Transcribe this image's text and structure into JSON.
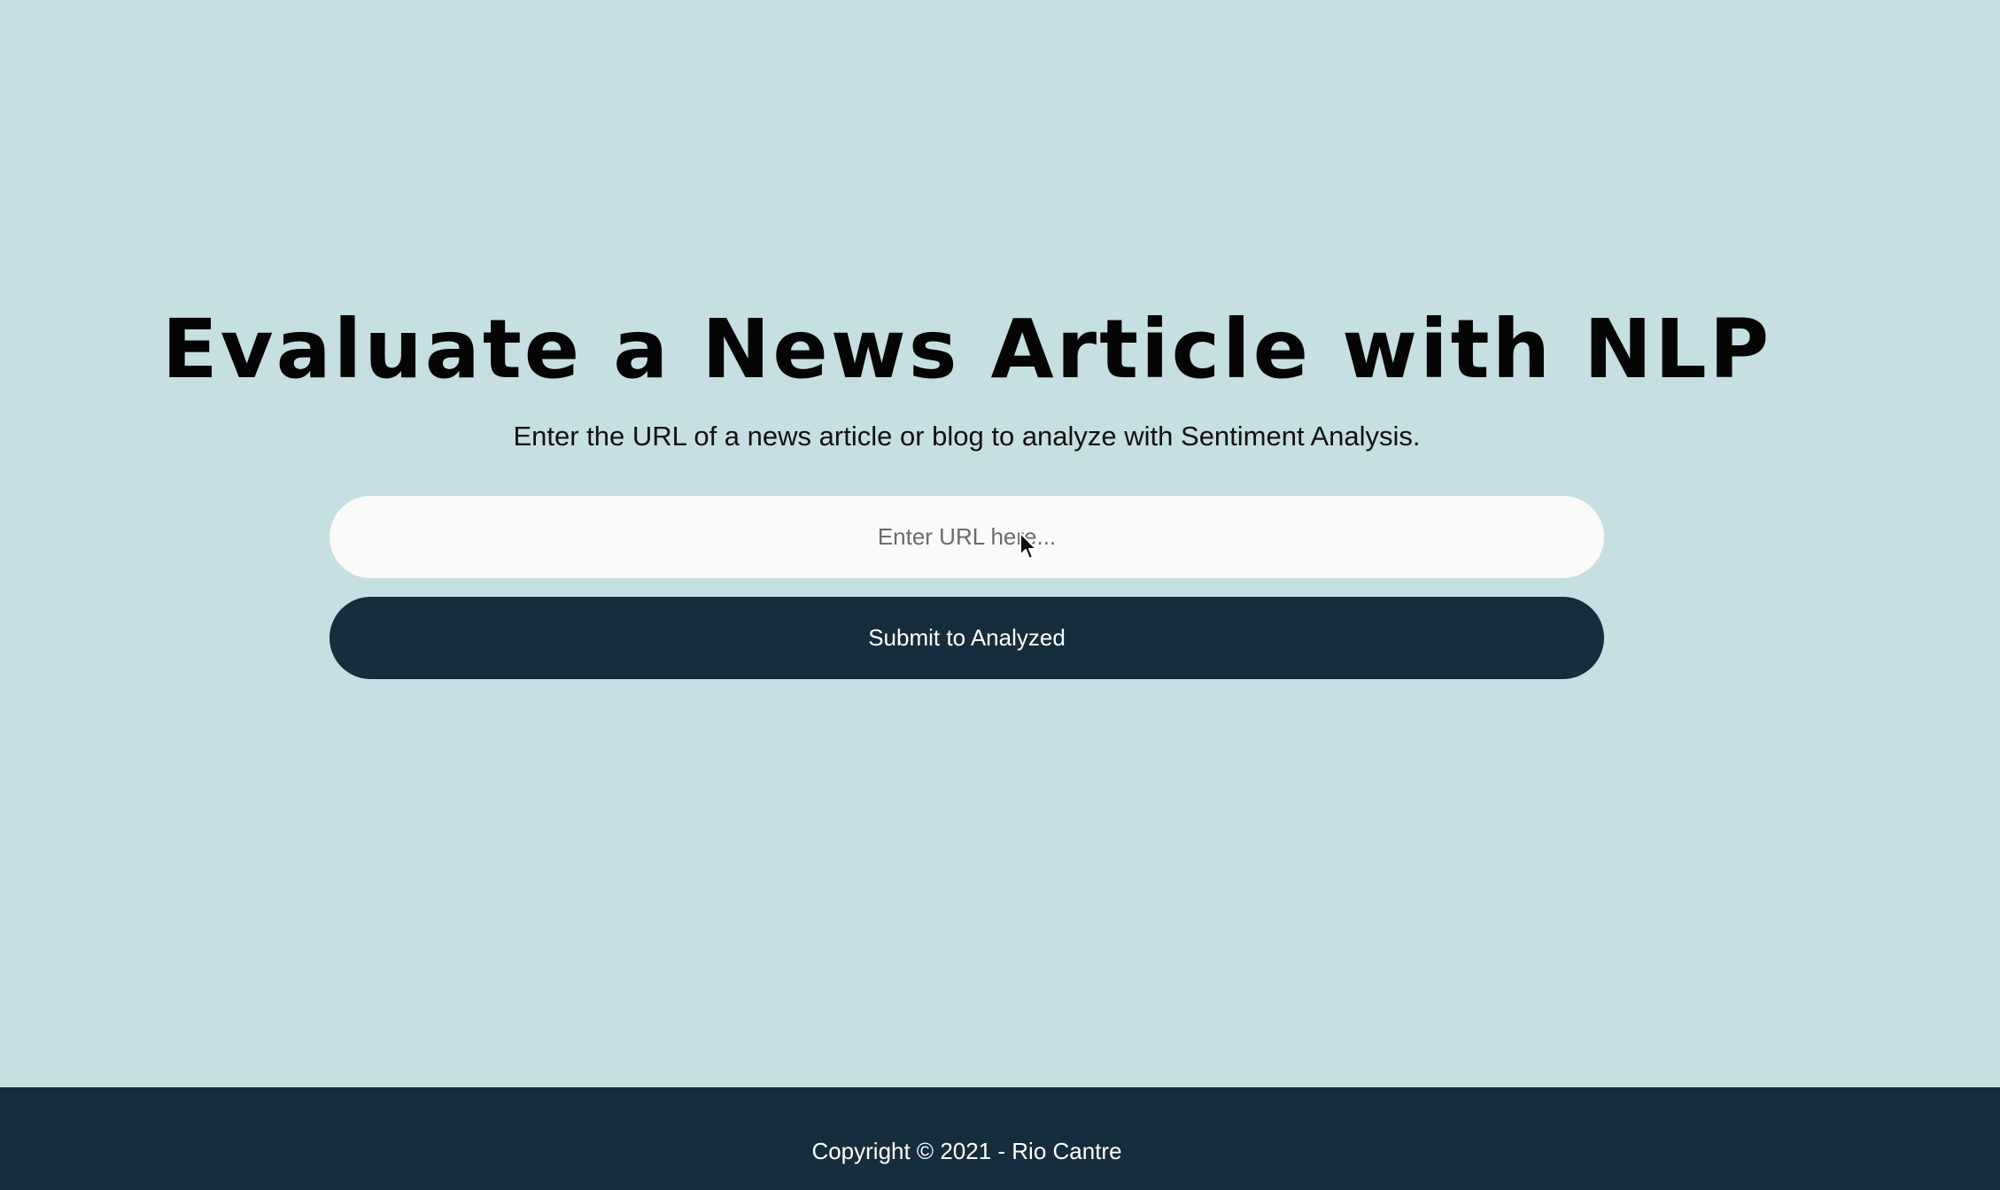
{
  "page": {
    "title": "Evaluate a News Article with NLP",
    "subtitle": "Enter the URL of a news article or blog to analyze with Sentiment Analysis."
  },
  "form": {
    "url_placeholder": "Enter URL here...",
    "url_value": "",
    "submit_label": "Submit to Analyzed"
  },
  "footer": {
    "copyright": "Copyright © 2021 -  Rio Cantre"
  },
  "icons": {
    "cursor": "mouse-pointer-icon"
  },
  "colors": {
    "background": "#c6dfe2",
    "footer": "#162d3e",
    "button": "#162d3e",
    "input": "#fafaf9",
    "title": "#050505"
  }
}
